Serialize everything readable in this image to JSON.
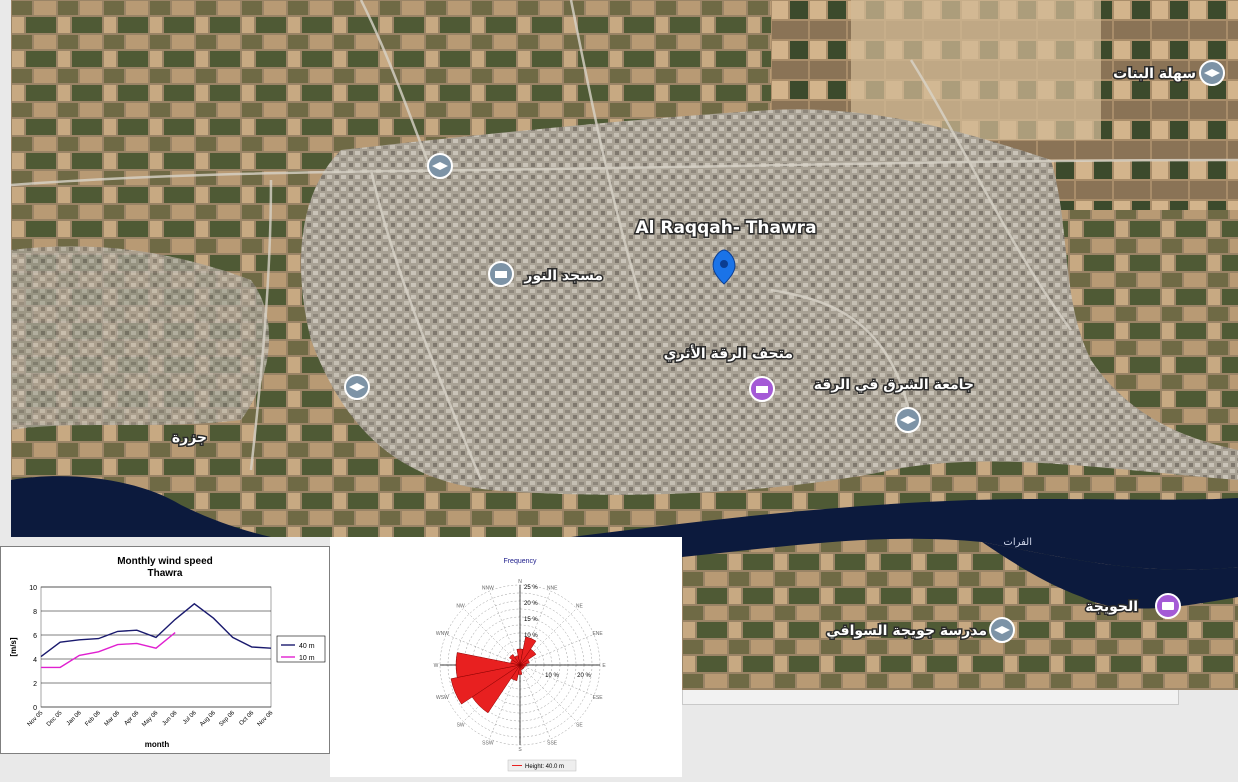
{
  "map": {
    "center_label": "Al Raqqah- Thawra",
    "places": [
      {
        "label": "سهلة البنات",
        "icon": "school-icon"
      },
      {
        "label": "مسجد النور",
        "icon": "mosque-icon"
      },
      {
        "label": "متحف الرقة الأثري",
        "icon": "museum-icon"
      },
      {
        "label": "جامعة الشرق في الرقة",
        "icon": "school-icon"
      },
      {
        "label": "جزرة",
        "icon": ""
      },
      {
        "label": "الفرات",
        "icon": ""
      },
      {
        "label": "الحويجة",
        "icon": "camera-icon"
      },
      {
        "label": "مدرسة جويجة السوافي",
        "icon": "school-icon"
      }
    ],
    "pin_color": "#1a73e8",
    "river_color": "#0c1a3d"
  },
  "chart_data": [
    {
      "type": "line",
      "title": "Monthly wind speed",
      "subtitle": "Thawra",
      "xlabel": "month",
      "ylabel": "[m/s]",
      "ylim": [
        0,
        10
      ],
      "yticks": [
        "0",
        "2",
        "4",
        "6",
        "8",
        "10"
      ],
      "categories": [
        "Nov 05",
        "Dec 05",
        "Jan 06",
        "Feb 06",
        "Mar 06",
        "Apr 06",
        "May 06",
        "Jun 06",
        "Jul 06",
        "Aug 06",
        "Sep 06",
        "Oct 06",
        "Nov 06"
      ],
      "series": [
        {
          "name": "40 m",
          "color": "#1a1a6e",
          "values": [
            4.2,
            5.4,
            5.6,
            5.7,
            6.3,
            6.4,
            5.8,
            7.3,
            8.6,
            7.4,
            5.8,
            5.0,
            4.9
          ]
        },
        {
          "name": "10 m",
          "color": "#e020d0",
          "values": [
            3.3,
            3.3,
            4.3,
            4.6,
            5.2,
            5.3,
            4.9,
            6.2
          ]
        }
      ],
      "grid": true,
      "legend": "right"
    },
    {
      "type": "wind-rose",
      "title": "Frequency",
      "radial_labels": [
        "25 %",
        "20 %",
        "15 %",
        "10 %"
      ],
      "axis_labels": [
        "10 %",
        "20 %"
      ],
      "directions": [
        "N",
        "NNE",
        "NE",
        "ENE",
        "E",
        "ESE",
        "SE",
        "SSE",
        "S",
        "SSW",
        "SW",
        "WSW",
        "W",
        "WNW",
        "NW",
        "NNW"
      ],
      "values": [
        5,
        9,
        6,
        3,
        2,
        1.5,
        1.5,
        1.5,
        3,
        5,
        18,
        22,
        20,
        3,
        4,
        3
      ],
      "color": "#e82020",
      "legend": "Height: 40.0 m"
    }
  ]
}
